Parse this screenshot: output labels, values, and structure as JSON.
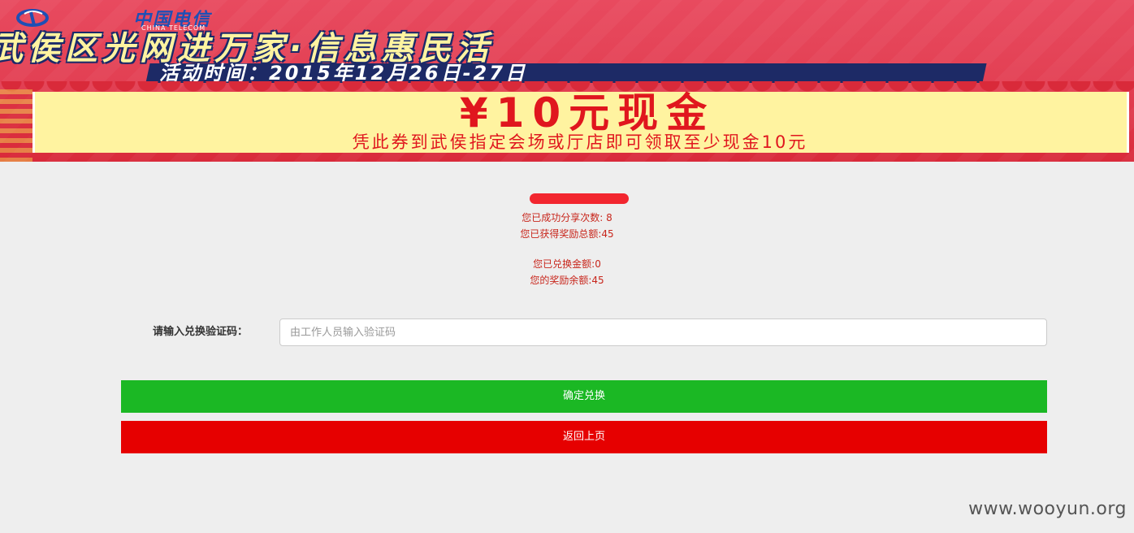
{
  "banner": {
    "brand_name": "中国电信",
    "brand_sub": "CHINA TELECOM",
    "headline": "武侯区光网进万家·信息惠民活",
    "date_text": "活动时间：2015年12月26日-27日",
    "coupon_amount": "¥10元现金",
    "coupon_note": "凭此券到武侯指定会场或厅店即可领取至少现金10元"
  },
  "stats": {
    "share_count": "您已成功分享次数: 8",
    "reward_total": "您已获得奖励总额:45",
    "exchanged": "您已兑换金额:0",
    "balance": "您的奖励余额:45"
  },
  "form": {
    "code_label": "请输入兑换验证码：",
    "code_placeholder": "由工作人员输入验证码",
    "code_value": ""
  },
  "buttons": {
    "confirm": "确定兑换",
    "back": "返回上页"
  },
  "watermark": "www.wooyun.org",
  "colors": {
    "confirm_bg": "#1bb824",
    "back_bg": "#e60000",
    "stats_text": "#c8261c",
    "page_bg": "#eeeeee"
  }
}
